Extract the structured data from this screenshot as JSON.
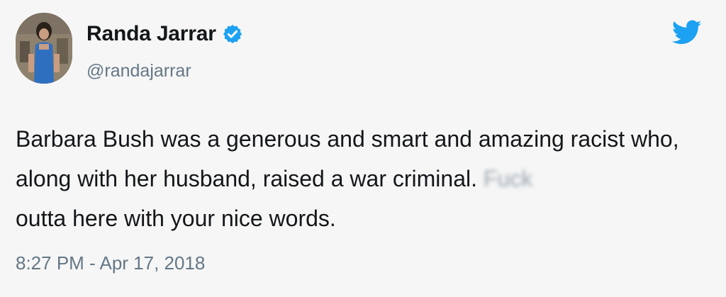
{
  "author": {
    "name": "Randa Jarrar",
    "handle": "@randajarrar",
    "verified": true
  },
  "tweet": {
    "text_main": "Barbara Bush was a generous and smart and amazing racist who, along with her husband, raised a war criminal.",
    "text_censored": "Fuck",
    "text_end": "outta here with your nice words.",
    "timestamp": "8:27 PM - Apr 17, 2018"
  },
  "icons": {
    "verified": "verified-badge-icon",
    "brand": "twitter-bird-icon"
  },
  "colors": {
    "text": "#14171a",
    "secondary": "#657786",
    "accent": "#1da1f2",
    "background": "#f6f6f6"
  }
}
